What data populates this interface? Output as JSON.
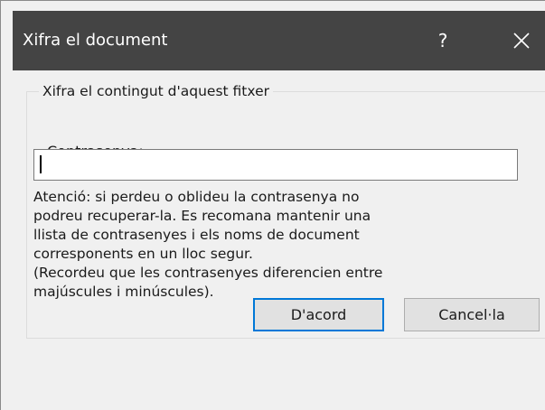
{
  "dialog": {
    "title": "Xifra el document",
    "help_label": "?",
    "close_icon": "close-icon"
  },
  "group": {
    "legend": "Xifra el contingut d'aquest fitxer",
    "password_label_pre": "Cont",
    "password_label_mnemonic": "r",
    "password_label_post": "asenya:",
    "password_value": ""
  },
  "warning": {
    "lines": [
      "Atenció: si perdeu o oblideu la contrasenya no",
      "podreu recuperar-la. Es recomana mantenir una",
      "llista de contrasenyes i els noms de document",
      "corresponents en un lloc segur.",
      "(Recordeu que les contrasenyes diferencien entre",
      "majúscules i minúscules)."
    ]
  },
  "buttons": {
    "ok": "D'acord",
    "cancel": "Cancel·la"
  },
  "colors": {
    "titlebar_bg": "#444444",
    "dialog_bg": "#f0f0f0",
    "default_button_border": "#0078d7"
  }
}
